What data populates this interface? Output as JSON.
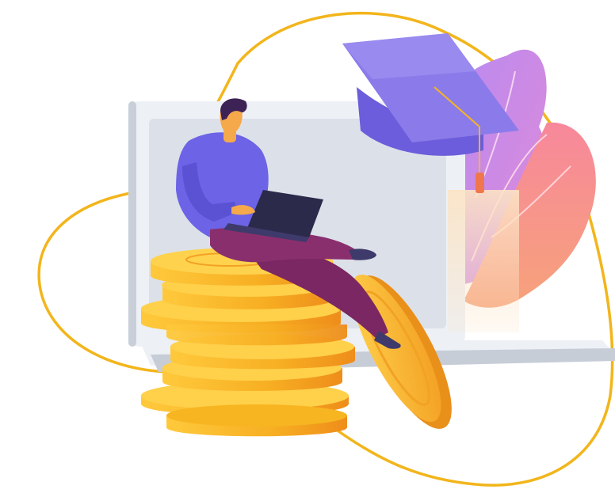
{
  "illustration": {
    "subject": "online-education-savings",
    "icons": [
      "blob-outline-icon",
      "laptop-icon",
      "graduation-cap-icon",
      "leaves-icon",
      "person-icon",
      "small-laptop-icon",
      "coin-stack-icon",
      "rolling-coin-icon"
    ],
    "colors": {
      "outline": "#F2B51B",
      "laptop_frame": "#EDF0F5",
      "laptop_screen": "#DADFE8",
      "laptop_base": "#C9CFD9",
      "cap_top": "#8B7BEA",
      "cap_band": "#6B5DDB",
      "tassel": "#F0764D",
      "leaf_purple": "#C98BE6",
      "leaf_pink": "#F7758F",
      "shirt": "#6C63E6",
      "pants": "#8A2F6E",
      "hair": "#3D2255",
      "skin": "#F5A94A",
      "coin_light": "#FFD04A",
      "coin_mid": "#F7B521",
      "coin_dark": "#E8901A"
    }
  }
}
